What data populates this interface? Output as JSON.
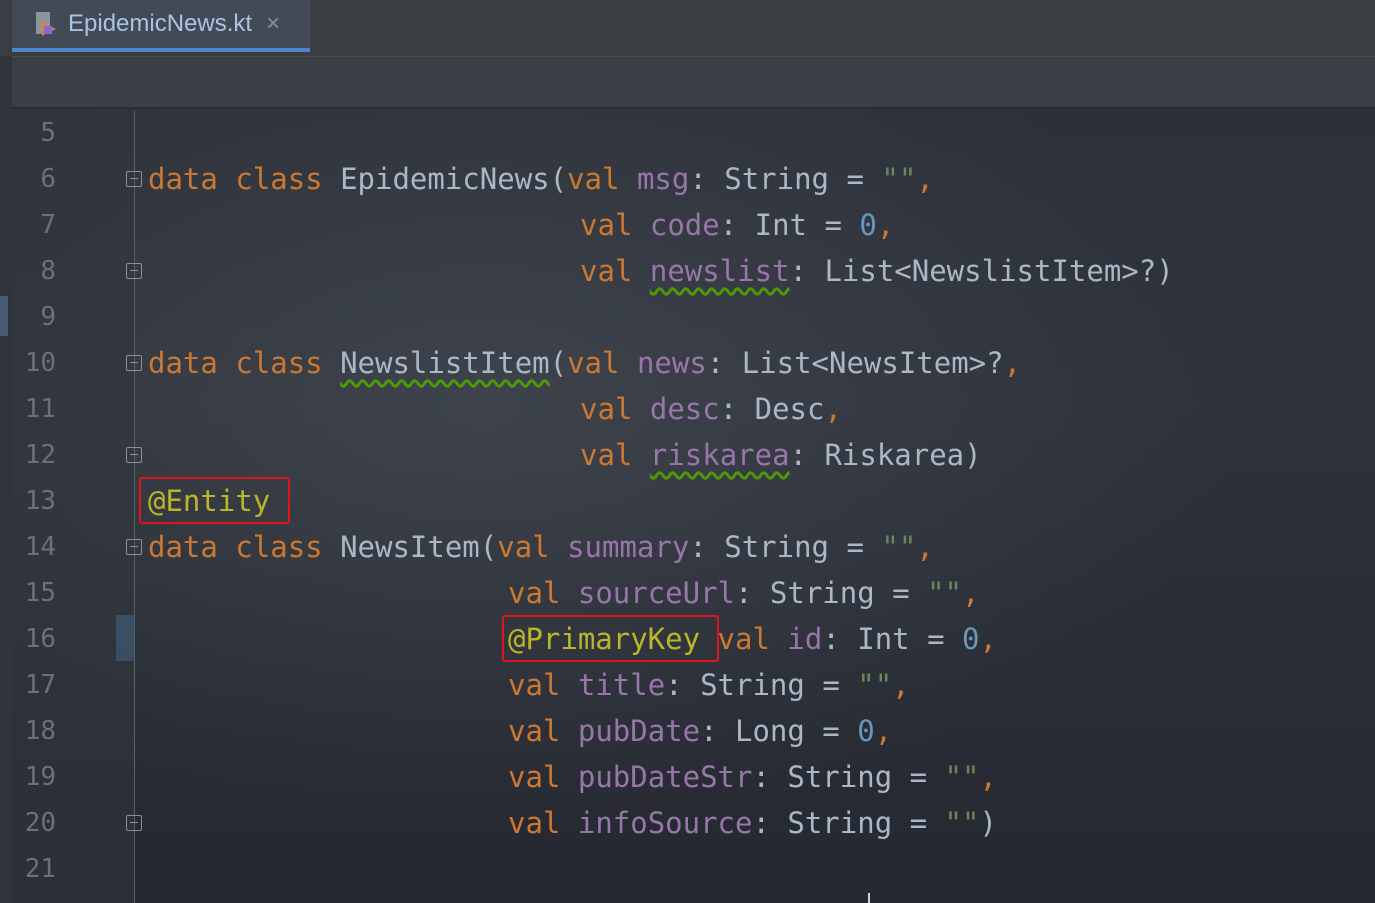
{
  "tab": {
    "filename": "EpidemicNews.kt",
    "close_glyph": "×"
  },
  "editor": {
    "line_numbers": [
      "5",
      "6",
      "7",
      "8",
      "9",
      "10",
      "11",
      "12",
      "13",
      "14",
      "15",
      "16",
      "17",
      "18",
      "19",
      "20",
      "21"
    ],
    "code": {
      "l6": {
        "kw1": "data",
        "kw2": "class",
        "name": "EpidemicNews(",
        "val": "val",
        "prop": "msg",
        "colon": ": ",
        "type": "String",
        "eq": " = ",
        "str": "\"\"",
        "end": ","
      },
      "l7": {
        "val": "val",
        "prop": "code",
        "colon": ": ",
        "type": "Int",
        "eq": " = ",
        "num": "0",
        "end": ","
      },
      "l8": {
        "val": "val",
        "prop": "newslist",
        "colon": ": ",
        "type": "List<NewslistItem>?)"
      },
      "l10": {
        "kw1": "data",
        "kw2": "class",
        "name": "NewslistItem",
        "paren": "(",
        "val": "val",
        "prop": "news",
        "colon": ": ",
        "type": "List<NewsItem>?",
        "end": ","
      },
      "l11": {
        "val": "val",
        "prop": "desc",
        "colon": ": ",
        "type": "Desc",
        "end": ","
      },
      "l12": {
        "val": "val",
        "prop": "riskarea",
        "colon": ": ",
        "type": "Riskarea)"
      },
      "l13": {
        "ann": "@Entity"
      },
      "l14": {
        "kw1": "data",
        "kw2": "class",
        "name": "NewsItem(",
        "val": "val",
        "prop": "summary",
        "colon": ": ",
        "type": "String",
        "eq": " = ",
        "str": "\"\"",
        "end": ","
      },
      "l15": {
        "val": "val",
        "prop": "sourceUrl",
        "colon": ": ",
        "type": "String",
        "eq": " = ",
        "str": "\"\"",
        "end": ","
      },
      "l16": {
        "ann": "@PrimaryKey",
        "val": "val",
        "prop": "id",
        "colon": ": ",
        "type": "Int",
        "eq": " = ",
        "num": "0",
        "end": ","
      },
      "l17": {
        "val": "val",
        "prop": "title",
        "colon": ": ",
        "type": "String",
        "eq": " = ",
        "str": "\"\"",
        "end": ","
      },
      "l18": {
        "val": "val",
        "prop": "pubDate",
        "colon": ": ",
        "type": "Long",
        "eq": " = ",
        "num": "0",
        "end": ","
      },
      "l19": {
        "val": "val",
        "prop": "pubDateStr",
        "colon": ": ",
        "type": "String",
        "eq": " = ",
        "str": "\"\"",
        "end": ","
      },
      "l20": {
        "val": "val",
        "prop": "infoSource",
        "colon": ": ",
        "type": "String",
        "eq": " = ",
        "str": "\"\"",
        "end": ")"
      }
    }
  },
  "colors": {
    "keyword": "#cc7832",
    "property": "#9876aa",
    "string": "#6a8759",
    "number": "#6897bb",
    "annotation": "#bbb529",
    "highlight": "#e0141a"
  }
}
